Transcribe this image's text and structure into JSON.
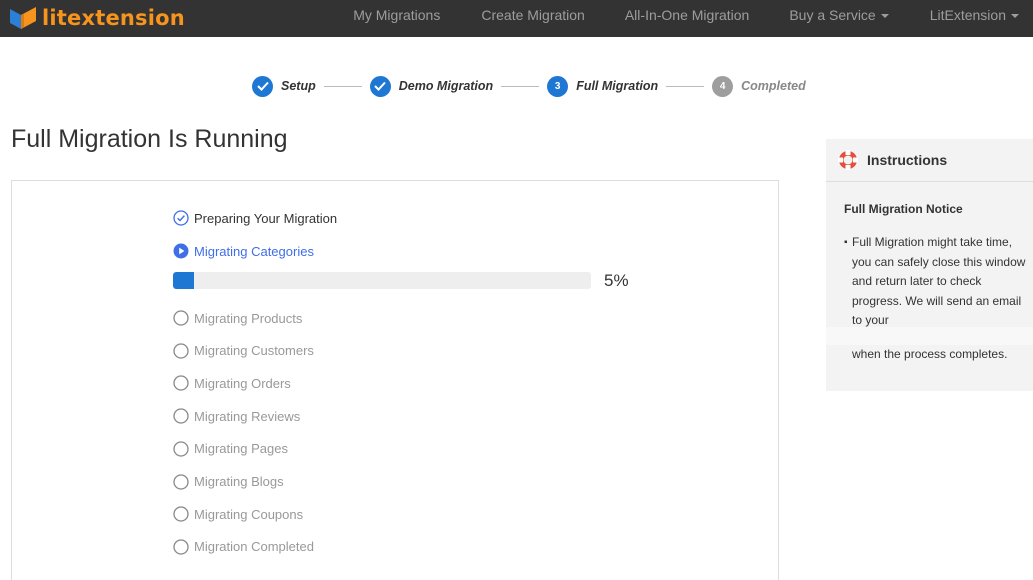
{
  "brand": {
    "name": "litextension",
    "logo_icon": "litextension-logo-icon",
    "accent": "#f7941d"
  },
  "nav": [
    {
      "label": "My Migrations",
      "dropdown": false
    },
    {
      "label": "Create Migration",
      "dropdown": false
    },
    {
      "label": "All-In-One Migration",
      "dropdown": false
    },
    {
      "label": "Buy a Service",
      "dropdown": true
    },
    {
      "label": "LitExtension",
      "dropdown": true
    }
  ],
  "stepper": [
    {
      "number": "",
      "label": "Setup",
      "status": "done"
    },
    {
      "number": "",
      "label": "Demo Migration",
      "status": "done"
    },
    {
      "number": "3",
      "label": "Full Migration",
      "status": "current"
    },
    {
      "number": "4",
      "label": "Completed",
      "status": "pending"
    }
  ],
  "page_title": "Full Migration Is Running",
  "tasks": [
    {
      "label": "Preparing Your Migration",
      "status": "done"
    },
    {
      "label": "Migrating Categories",
      "status": "active"
    },
    {
      "label": "Migrating Products",
      "status": "pending"
    },
    {
      "label": "Migrating Customers",
      "status": "pending"
    },
    {
      "label": "Migrating Orders",
      "status": "pending"
    },
    {
      "label": "Migrating Reviews",
      "status": "pending"
    },
    {
      "label": "Migrating Pages",
      "status": "pending"
    },
    {
      "label": "Migrating Blogs",
      "status": "pending"
    },
    {
      "label": "Migrating Coupons",
      "status": "pending"
    },
    {
      "label": "Migration Completed",
      "status": "pending"
    }
  ],
  "progress": {
    "percent": 5,
    "label": "5%"
  },
  "instructions": {
    "title": "Instructions",
    "icon": "lifebuoy-icon",
    "notice_title": "Full Migration Notice",
    "notice_text": "Full Migration might take time, you can safely close this window and return later to check progress. We will send an email to your",
    "notice_tail": "when the process completes."
  },
  "colors": {
    "navbar": "#333333",
    "primary": "#1e77d3",
    "active_text": "#3e6ee8",
    "muted": "#999999"
  }
}
